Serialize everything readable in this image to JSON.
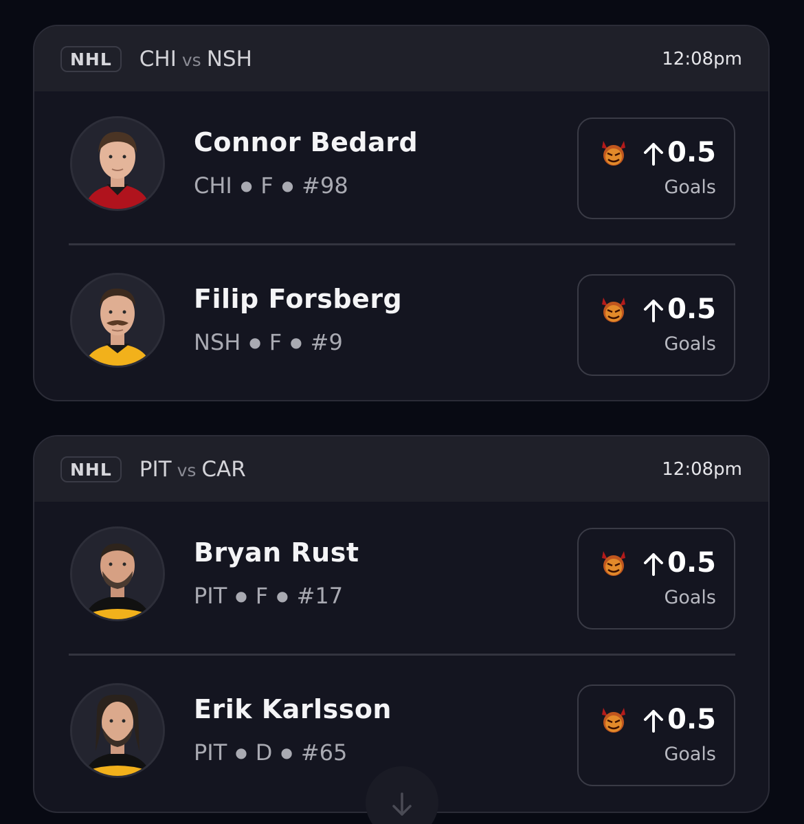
{
  "games": [
    {
      "league": "NHL",
      "away_team": "CHI",
      "vs_label": "vs",
      "home_team": "NSH",
      "time": "12:08pm",
      "players": [
        {
          "name": "Connor Bedard",
          "team": "CHI",
          "position": "F",
          "number": "#98",
          "pick_direction": "up-arrow-icon",
          "line": "0.5",
          "stat": "Goals",
          "jersey_color": "#b0131d"
        },
        {
          "name": "Filip Forsberg",
          "team": "NSH",
          "position": "F",
          "number": "#9",
          "pick_direction": "up-arrow-icon",
          "line": "0.5",
          "stat": "Goals",
          "jersey_color": "#f2b11b"
        }
      ]
    },
    {
      "league": "NHL",
      "away_team": "PIT",
      "vs_label": "vs",
      "home_team": "CAR",
      "time": "12:08pm",
      "players": [
        {
          "name": "Bryan Rust",
          "team": "PIT",
          "position": "F",
          "number": "#17",
          "pick_direction": "up-arrow-icon",
          "line": "0.5",
          "stat": "Goals",
          "jersey_color": "#111111"
        },
        {
          "name": "Erik Karlsson",
          "team": "PIT",
          "position": "D",
          "number": "#65",
          "pick_direction": "up-arrow-icon",
          "line": "0.5",
          "stat": "Goals",
          "jersey_color": "#111111"
        }
      ]
    }
  ],
  "icons": {
    "pick_badge": "devil-emoji-icon",
    "scroll": "down-arrow-icon"
  },
  "colors": {
    "background": "#080a13",
    "card": "#141520",
    "card_header": "#1f2029",
    "border": "#3a3b46"
  }
}
